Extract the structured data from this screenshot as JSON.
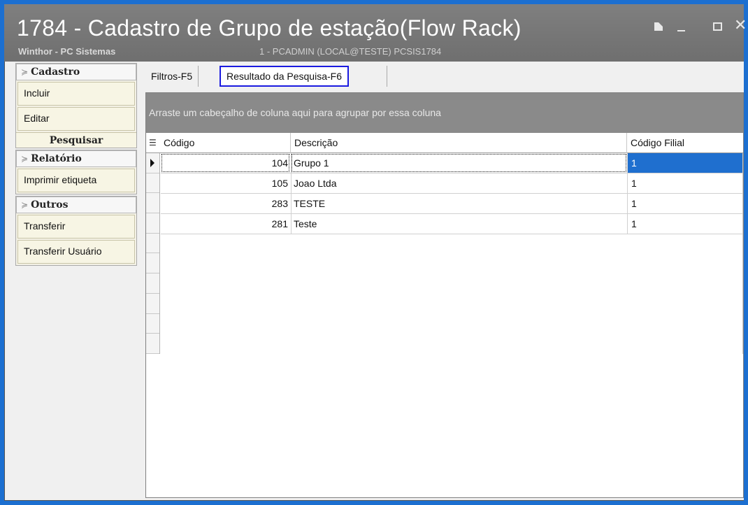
{
  "window": {
    "title": "1784 - Cadastro de Grupo de estação(Flow Rack)",
    "subtitle_left": "Winthor - PC Sistemas",
    "subtitle_right": "1 - PCADMIN (LOCAL@TESTE)   PCSIS1784",
    "accent_color": "#1c6fd0"
  },
  "sidebar": {
    "cadastro": {
      "label": "Cadastro",
      "items": [
        "Incluir",
        "Editar"
      ]
    },
    "pesquisar": {
      "label": "Pesquisar"
    },
    "relatorio": {
      "label": "Relatório",
      "items": [
        "Imprimir etiqueta"
      ]
    },
    "outros": {
      "label": "Outros",
      "items": [
        "Transferir",
        "Transferir Usuário"
      ]
    }
  },
  "tabs": [
    {
      "label": "Filtros-F5"
    },
    {
      "label": "Resultado da Pesquisa-F6",
      "active": true
    }
  ],
  "grid": {
    "group_panel_text": "Arraste um cabeçalho de coluna aqui para agrupar por essa coluna",
    "columns": [
      "Código",
      "Descrição",
      "Código Filial"
    ],
    "rows": [
      {
        "codigo": "104",
        "descricao": "Grupo 1",
        "filial": "1",
        "selected": true
      },
      {
        "codigo": "105",
        "descricao": "Joao Ltda",
        "filial": "1"
      },
      {
        "codigo": "283",
        "descricao": "TESTE",
        "filial": "1"
      },
      {
        "codigo": "281",
        "descricao": "Teste",
        "filial": "1"
      }
    ],
    "selection_color": "#1f6fcf"
  }
}
